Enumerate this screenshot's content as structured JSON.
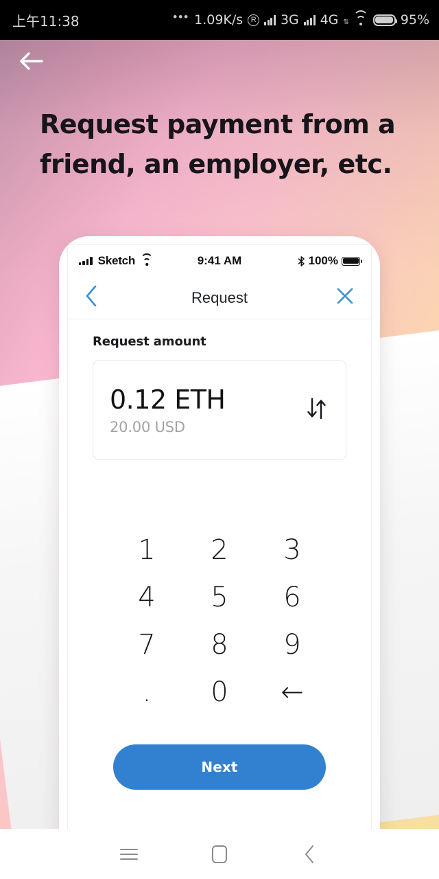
{
  "system_status_bar": {
    "clock": "上午11:38",
    "overflow_dots": "•••",
    "network_speed": "1.09K/s",
    "roaming_badge": "R",
    "network_1": "3G",
    "network_2": "4G",
    "battery_percent": "95%",
    "icons": [
      "signal-bars-icon",
      "wifi-icon",
      "battery-icon"
    ]
  },
  "page": {
    "back_icon": "arrow-left-icon",
    "headline": "Request payment from a friend, an employer, etc.",
    "background_colors": {
      "gradient_start": "#c79cb4",
      "gradient_pink": "#f9b8d0",
      "gradient_peach": "#fbd4b2",
      "gradient_end": "#f7dfa2",
      "sheet": "#ffffff"
    }
  },
  "phone": {
    "ios_status_bar": {
      "carrier": "Sketch",
      "time": "9:41 AM",
      "battery_percent": "100%",
      "bluetooth_glyph": "✻",
      "icons": [
        "signal-bars-icon",
        "wifi-icon",
        "bluetooth-icon",
        "battery-icon"
      ]
    },
    "nav": {
      "back_icon": "chevron-left-icon",
      "title": "Request",
      "close_icon": "close-x-icon",
      "accent_color": "#3b8fd4"
    },
    "amount": {
      "label": "Request amount",
      "crypto_value": "0.12 ETH",
      "fiat_value": "20.00 USD",
      "swap_icon": "swap-vertical-icon"
    },
    "keypad": [
      {
        "name": "key-1",
        "label": "1"
      },
      {
        "name": "key-2",
        "label": "2"
      },
      {
        "name": "key-3",
        "label": "3"
      },
      {
        "name": "key-4",
        "label": "4"
      },
      {
        "name": "key-5",
        "label": "5"
      },
      {
        "name": "key-6",
        "label": "6"
      },
      {
        "name": "key-7",
        "label": "7"
      },
      {
        "name": "key-8",
        "label": "8"
      },
      {
        "name": "key-9",
        "label": "9"
      },
      {
        "name": "key-decimal",
        "label": "."
      },
      {
        "name": "key-0",
        "label": "0"
      },
      {
        "name": "key-backspace",
        "label": "←"
      }
    ],
    "next_button": {
      "label": "Next",
      "color": "#3280d0"
    }
  },
  "android_nav_bar": {
    "menu_icon": "menu-hamburger-icon",
    "home_icon": "home-square-icon",
    "back_icon": "chevron-left-icon"
  }
}
